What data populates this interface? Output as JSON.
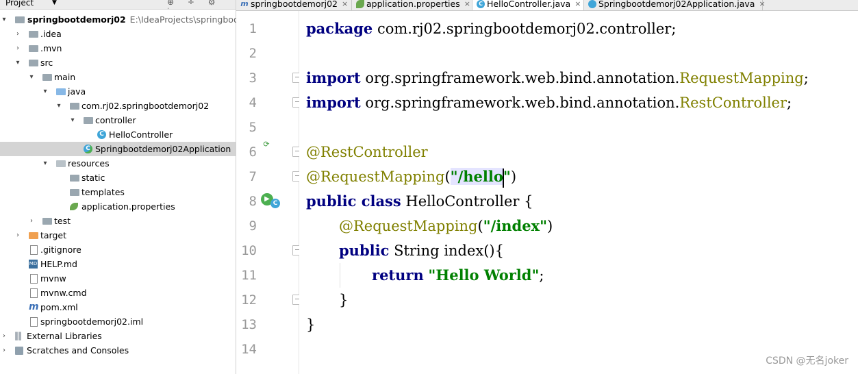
{
  "project_panel": {
    "title": "Project",
    "tools": "⊕ ÷ ⚙ ⊢",
    "tree": [
      {
        "label": "springbootdemorj02",
        "path": "E:\\IdeaProjects\\springbootde",
        "bold": true
      },
      {
        "label": ".idea"
      },
      {
        "label": ".mvn"
      },
      {
        "label": "src"
      },
      {
        "label": "main"
      },
      {
        "label": "java"
      },
      {
        "label": "com.rj02.springbootdemorj02"
      },
      {
        "label": "controller"
      },
      {
        "label": "HelloController",
        "icon_text": "C"
      },
      {
        "label": "Springbootdemorj02Application",
        "icon_text": "C"
      },
      {
        "label": "resources"
      },
      {
        "label": "static"
      },
      {
        "label": "templates"
      },
      {
        "label": "application.properties"
      },
      {
        "label": "test"
      },
      {
        "label": "target"
      },
      {
        "label": ".gitignore"
      },
      {
        "label": "HELP.md",
        "icon_text": "MD"
      },
      {
        "label": "mvnw"
      },
      {
        "label": "mvnw.cmd"
      },
      {
        "label": "pom.xml",
        "icon_text": "m"
      },
      {
        "label": "springbootdemorj02.iml"
      },
      {
        "label": "External Libraries"
      },
      {
        "label": "Scratches and Consoles"
      }
    ]
  },
  "tabs": [
    {
      "label": "springbootdemorj02",
      "close": "×",
      "icon_text": "m"
    },
    {
      "label": "application.properties",
      "close": "×"
    },
    {
      "label": "HelloController.java",
      "close": "×",
      "icon_text": "C"
    },
    {
      "label": "Springbootdemorj02Application.java",
      "close": "×"
    }
  ],
  "editor": {
    "line_numbers": [
      "1",
      "2",
      "3",
      "4",
      "5",
      "6",
      "7",
      "8",
      "9",
      "10",
      "11",
      "12",
      "13",
      "14"
    ],
    "gutter_icons": {
      "run": "⟳",
      "run_big": "▶",
      "class": "C"
    },
    "code": {
      "l1_kw": "package",
      "l1_rest": " com.rj02.springbootdemorj02.controller;",
      "l3_kw": "import",
      "l3_rest": " org.springframework.web.bind.annotation.",
      "l3_ann": "RequestMapping",
      "l3_end": ";",
      "l4_kw": "import",
      "l4_rest": " org.springframework.web.bind.annotation.",
      "l4_ann": "RestController",
      "l4_end": ";",
      "l6_ann": "@RestController",
      "l7_ann": "@RequestMapping",
      "l7_open": "(",
      "l7_str_a": "\"/hello",
      "l7_str_b": "\"",
      "l7_close": ")",
      "l8_kw": "public class",
      "l8_rest": " HelloController {",
      "l9_ann": "@RequestMapping",
      "l9_open": "(",
      "l9_str": "\"/index\"",
      "l9_close": ")",
      "l10_kw": "public",
      "l10_rest": " String index(){",
      "l11_kw": "return",
      "l11_str": "\"Hello World\"",
      "l11_end": ";",
      "l12": "}",
      "l13": "}"
    }
  },
  "watermark": "CSDN @无名joker"
}
